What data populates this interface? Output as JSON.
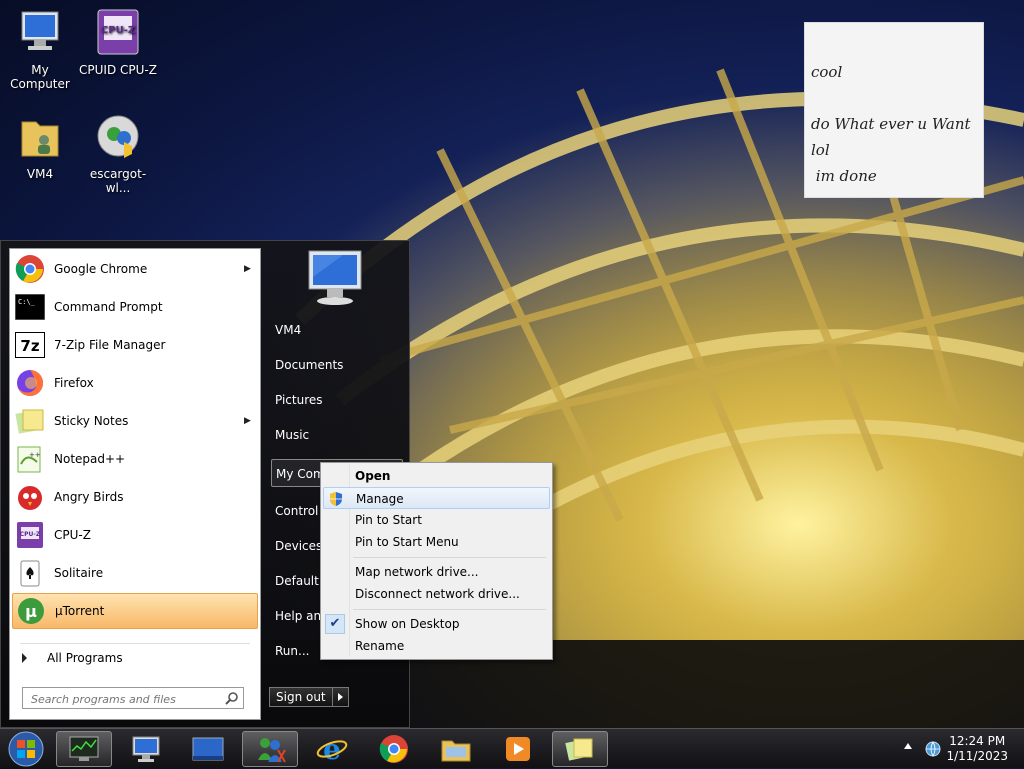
{
  "desktop": {
    "icons": [
      {
        "label": "My Computer",
        "icon": "my-computer-icon"
      },
      {
        "label": "CPUID CPU-Z",
        "icon": "cpuz-icon"
      },
      {
        "label": "VM4",
        "icon": "user-folder-icon"
      },
      {
        "label": "escargot-wl...",
        "icon": "msn-icon"
      }
    ]
  },
  "sticky_note": {
    "lines": [
      "cool",
      "",
      "do What ever u Want",
      "lol",
      " im done"
    ]
  },
  "start_menu": {
    "programs": [
      {
        "label": "Google Chrome",
        "icon": "chrome-icon",
        "submenu": true
      },
      {
        "label": "Command Prompt",
        "icon": "cmd-icon",
        "submenu": false
      },
      {
        "label": "7-Zip File Manager",
        "icon": "7zip-icon",
        "submenu": false
      },
      {
        "label": "Firefox",
        "icon": "firefox-icon",
        "submenu": false
      },
      {
        "label": "Sticky Notes",
        "icon": "sticky-notes-icon",
        "submenu": true
      },
      {
        "label": "Notepad++",
        "icon": "notepadpp-icon",
        "submenu": false
      },
      {
        "label": "Angry Birds",
        "icon": "angry-birds-icon",
        "submenu": false
      },
      {
        "label": "CPU-Z",
        "icon": "cpuz-icon",
        "submenu": false
      },
      {
        "label": "Solitaire",
        "icon": "solitaire-icon",
        "submenu": false
      },
      {
        "label": "µTorrent",
        "icon": "utorrent-icon",
        "submenu": false
      }
    ],
    "all_programs": "All Programs",
    "search_placeholder": "Search programs and files",
    "right_items": [
      "VM4",
      "Documents",
      "Pictures",
      "Music",
      "My Computer",
      "Control Panel",
      "Devices and Printers",
      "Default Programs",
      "Help and Support",
      "Run..."
    ],
    "right_items_visible": [
      "VM4",
      "Documents",
      "Pictures",
      "Music",
      "My Com",
      "Control P",
      "Devices a",
      "Default P",
      "Help and",
      "Run..."
    ],
    "sign_out": "Sign out"
  },
  "context_menu": {
    "items": [
      {
        "label": "Open",
        "bold": true
      },
      {
        "label": "Manage",
        "shield": true,
        "highlighted": true
      },
      {
        "label": "Pin to Start"
      },
      {
        "label": "Pin to Start Menu"
      },
      {
        "label": "Map network drive..."
      },
      {
        "label": "Disconnect network drive..."
      },
      {
        "label": "Show on Desktop",
        "checked": true
      },
      {
        "label": "Rename"
      }
    ]
  },
  "taskbar": {
    "time": "12:24 PM",
    "date": "1/11/2023"
  },
  "colors": {
    "highlight": "#f8b868",
    "menu_hover": "#dce8f6"
  }
}
